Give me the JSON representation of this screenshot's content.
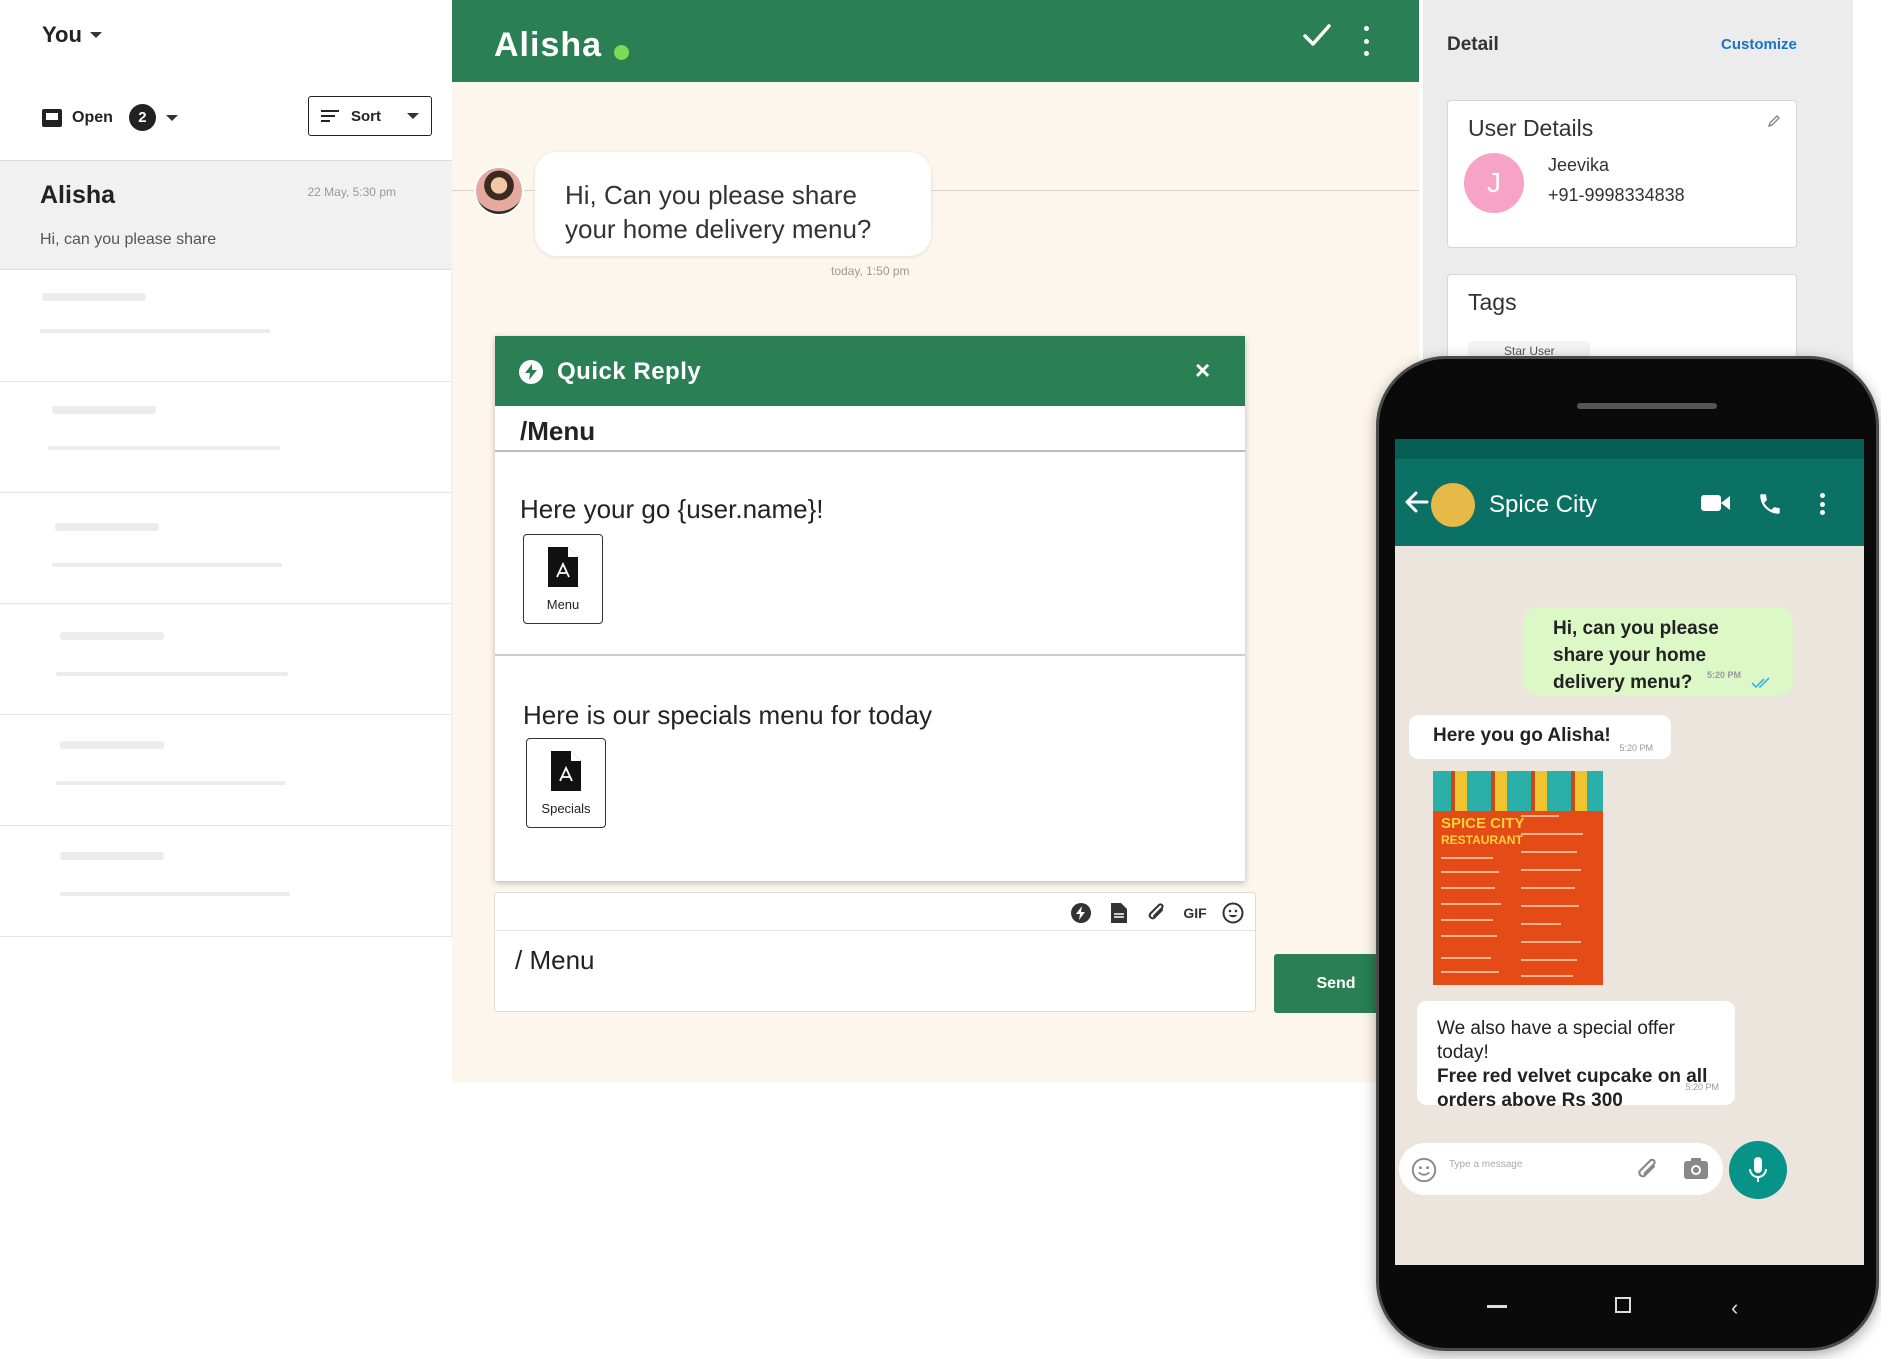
{
  "sidebar": {
    "owner": "You",
    "filter_label": "Open",
    "filter_count": "2",
    "sort_label": "Sort",
    "conversation": {
      "name": "Alisha",
      "time": "22 May, 5:30 pm",
      "preview": "Hi, can you please share"
    }
  },
  "chat": {
    "contact_name": "Alisha",
    "incoming_message": "Hi, Can you please share your home delivery menu?",
    "incoming_time": "today, 1:50 pm",
    "quick_reply": {
      "title": "Quick Reply",
      "close_label": "×",
      "command": "/Menu",
      "options": [
        {
          "text": "Here your go {user.name}!",
          "file_label": "Menu"
        },
        {
          "text": "Here is our specials menu for today",
          "file_label": "Specials"
        }
      ]
    },
    "composer": {
      "text": "/ Menu",
      "tools": [
        "bolt-icon",
        "document-icon",
        "paperclip-icon",
        "GIF",
        "emoji-icon"
      ],
      "gif_label": "GIF"
    },
    "send_label": "Send"
  },
  "detail": {
    "title": "Detail",
    "customize_label": "Customize",
    "user_details": {
      "title": "User Details",
      "avatar_initial": "J",
      "name": "Jeevika",
      "phone": "+91-9998334838"
    },
    "tags": {
      "title": "Tags",
      "chip": "Star User"
    }
  },
  "phone": {
    "contact_name": "Spice City",
    "outgoing": {
      "text": "Hi, can you please share your home delivery menu?",
      "time": "5:20 PM"
    },
    "reply1": {
      "text": "Here you go Alisha!",
      "time": "5:20 PM"
    },
    "menu_image": {
      "title_line1": "SPICE CITY",
      "title_line2": "RESTAURANT"
    },
    "reply2": {
      "line1": "We also have a special offer today!",
      "line2": "Free red velvet cupcake on all orders above Rs 300",
      "time": "5:20 PM"
    },
    "input_placeholder": "Type a message"
  },
  "colors": {
    "brand_green": "#2a7f54",
    "chat_bg": "#fdf6ec",
    "wa_header": "#0b7164",
    "wa_outgoing": "#dcf8c6",
    "wa_mic": "#079388",
    "online": "#7ddc52",
    "avatar_pink": "#f7a3c6",
    "link_blue": "#1a73c8"
  }
}
